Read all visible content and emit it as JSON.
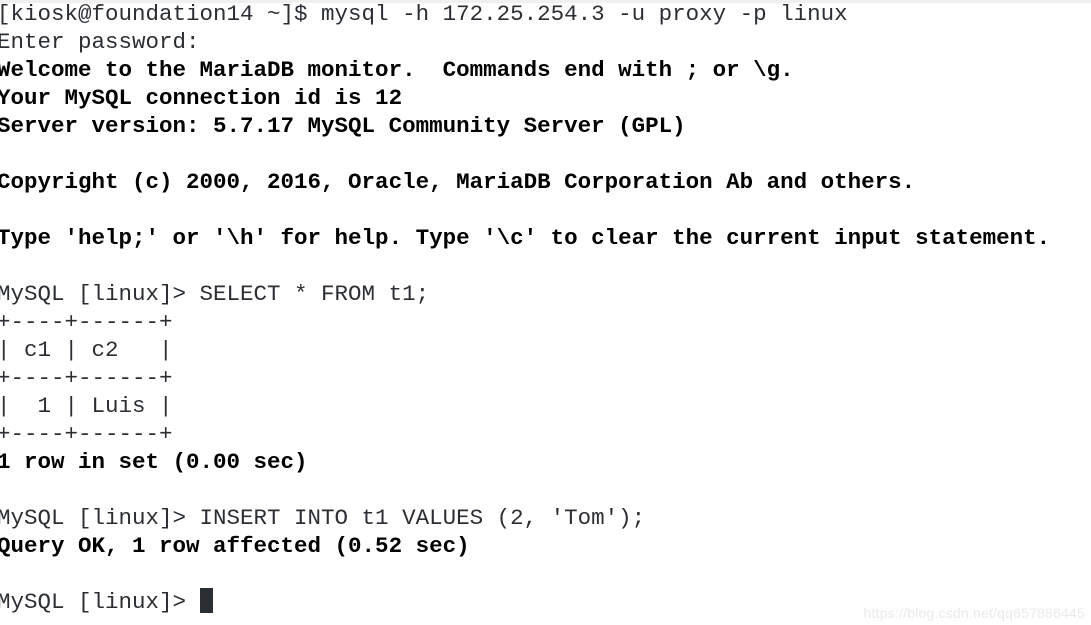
{
  "terminal": {
    "background_color": "#ffffff",
    "text_color": "#2b2f33",
    "bold_text_color": "#000000",
    "cursor_color": "#2b2f33",
    "lines": [
      {
        "text": "[kiosk@foundation14 ~]$ mysql -h 172.25.254.3 -u proxy -p linux",
        "bold": false
      },
      {
        "text": "Enter password:",
        "bold": false
      },
      {
        "text": "Welcome to the MariaDB monitor.  Commands end with ; or \\g.",
        "bold": true
      },
      {
        "text": "Your MySQL connection id is 12",
        "bold": true
      },
      {
        "text": "Server version: 5.7.17 MySQL Community Server (GPL)",
        "bold": true
      },
      {
        "text": "",
        "bold": false
      },
      {
        "text": "Copyright (c) 2000, 2016, Oracle, MariaDB Corporation Ab and others.",
        "bold": true
      },
      {
        "text": "",
        "bold": false
      },
      {
        "text": "Type 'help;' or '\\h' for help. Type '\\c' to clear the current input statement.",
        "bold": true
      },
      {
        "text": "",
        "bold": false
      },
      {
        "text": "MySQL [linux]> SELECT * FROM t1;",
        "bold": false
      },
      {
        "text": "+----+------+",
        "bold": false
      },
      {
        "text": "| c1 | c2   |",
        "bold": false
      },
      {
        "text": "+----+------+",
        "bold": false
      },
      {
        "text": "|  1 | Luis |",
        "bold": false
      },
      {
        "text": "+----+------+",
        "bold": false
      },
      {
        "text": "1 row in set (0.00 sec)",
        "bold": true
      },
      {
        "text": "",
        "bold": false
      },
      {
        "text": "MySQL [linux]> INSERT INTO t1 VALUES (2, 'Tom');",
        "bold": false
      },
      {
        "text": "Query OK, 1 row affected (0.52 sec)",
        "bold": true
      },
      {
        "text": "",
        "bold": false
      }
    ],
    "prompt_line": {
      "text": "MySQL [linux]> ",
      "bold": false,
      "cursor": "block-cursor"
    },
    "session": {
      "shell_prompt": "[kiosk@foundation14 ~]$",
      "command": "mysql -h 172.25.254.3 -u proxy -p linux",
      "host": "172.25.254.3",
      "user": "proxy",
      "database": "linux",
      "connection_id": "12",
      "server_version": "5.7.17 MySQL Community Server (GPL)",
      "client": "MariaDB monitor"
    },
    "query_result": {
      "headers": [
        "c1",
        "c2"
      ],
      "rows": [
        [
          "1",
          "Luis"
        ]
      ],
      "status": "1 row in set (0.00 sec)"
    },
    "insert_result": {
      "query": "INSERT INTO t1 VALUES (2, 'Tom');",
      "status": "Query OK, 1 row affected (0.52 sec)"
    }
  },
  "watermark": {
    "text": "https://blog.csdn.net/qq657886445"
  }
}
